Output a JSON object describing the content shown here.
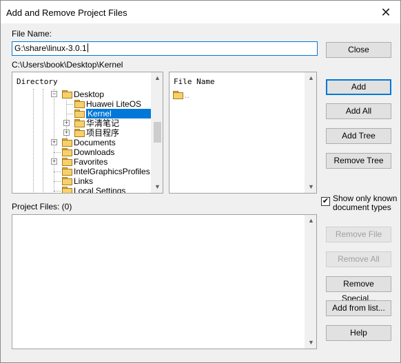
{
  "window": {
    "title": "Add and Remove Project Files",
    "close_glyph": "✕"
  },
  "file_name": {
    "label": "File Name:",
    "value": "G:\\share\\linux-3.0.1"
  },
  "current_path": "C:\\Users\\book\\Desktop\\Kernel",
  "directory_panel": {
    "header": "Directory",
    "items": [
      {
        "label": "Desktop",
        "expander": "−"
      },
      {
        "label": "Huawei LiteOS",
        "expander": ""
      },
      {
        "label": "Kernel",
        "expander": "",
        "selected": true
      },
      {
        "label": "华清笔记",
        "expander": "+"
      },
      {
        "label": "项目程序",
        "expander": "+"
      },
      {
        "label": "Documents",
        "expander": "+"
      },
      {
        "label": "Downloads",
        "expander": ""
      },
      {
        "label": "Favorites",
        "expander": "+"
      },
      {
        "label": "IntelGraphicsProfiles",
        "expander": ""
      },
      {
        "label": "Links",
        "expander": ""
      },
      {
        "label": "Local Settings",
        "expander": ""
      }
    ]
  },
  "file_panel": {
    "header": "File Name",
    "items": [
      {
        "label": ".."
      }
    ]
  },
  "project_files": {
    "label": "Project Files: (0)"
  },
  "show_only_known": {
    "label_line1": "Show only known",
    "label_line2": "document types",
    "checked": true,
    "check_glyph": "✔"
  },
  "buttons": {
    "close": "Close",
    "add": "Add",
    "add_all": "Add All",
    "add_tree": "Add Tree",
    "remove_tree": "Remove Tree",
    "remove_file": "Remove File",
    "remove_all": "Remove All",
    "remove_special": "Remove Special...",
    "add_from_list": "Add from list...",
    "help": "Help"
  },
  "scroll_glyphs": {
    "up": "▲",
    "down": "▼"
  }
}
